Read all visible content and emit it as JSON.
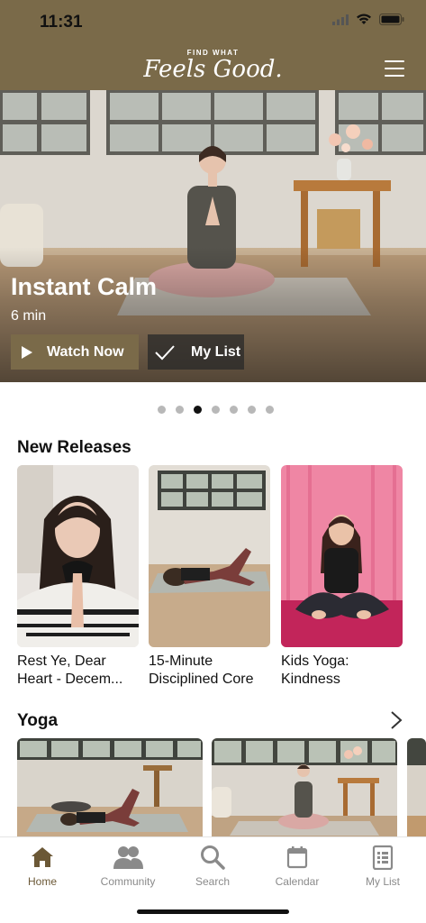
{
  "status_bar": {
    "time": "11:31"
  },
  "header": {
    "logo_top": "FIND WHAT",
    "logo_main": "Feels Good."
  },
  "hero": {
    "title": "Instant Calm",
    "duration": "6 min",
    "watch_label": "Watch Now",
    "mylist_label": "My List"
  },
  "carousel": {
    "slide_count": 7,
    "active_index": 2
  },
  "new_releases": {
    "title": "New Releases",
    "items": [
      {
        "line1": "Rest Ye, Dear",
        "line2": "Heart - Decem..."
      },
      {
        "line1": "15-Minute",
        "line2": "Disciplined Core"
      },
      {
        "line1": "Kids Yoga:",
        "line2": "Kindness"
      }
    ]
  },
  "yoga": {
    "title": "Yoga"
  },
  "tabbar": {
    "items": [
      {
        "label": "Home",
        "icon": "home-icon",
        "active": true
      },
      {
        "label": "Community",
        "icon": "community-icon",
        "active": false
      },
      {
        "label": "Search",
        "icon": "search-icon",
        "active": false
      },
      {
        "label": "Calendar",
        "icon": "calendar-icon",
        "active": false
      },
      {
        "label": "My List",
        "icon": "list-icon",
        "active": false
      }
    ]
  },
  "colors": {
    "brand": "#7a6a49",
    "active_tab": "#6b5836",
    "inactive_tab": "#8a8a8a"
  }
}
